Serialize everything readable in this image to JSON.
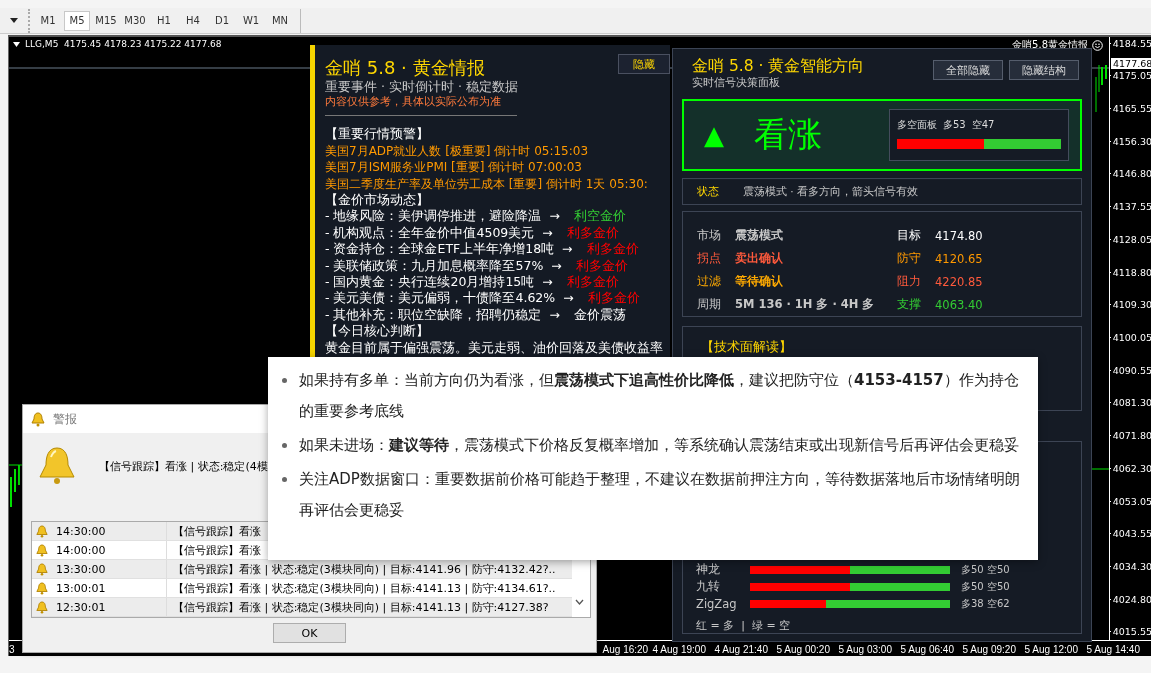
{
  "toolbar": {
    "timeframes": [
      {
        "label": "M1",
        "selected": false
      },
      {
        "label": "M5",
        "selected": true
      },
      {
        "label": "M15",
        "selected": false
      },
      {
        "label": "M30",
        "selected": false
      },
      {
        "label": "H1",
        "selected": false
      },
      {
        "label": "H4",
        "selected": false
      },
      {
        "label": "D1",
        "selected": false
      },
      {
        "label": "W1",
        "selected": false
      },
      {
        "label": "MN",
        "selected": false
      }
    ]
  },
  "chart": {
    "header": "LLG,M5  4175.45 4178.23 4175.22 4177.68",
    "corner_label": "金哨5.8黄金情报",
    "current_price": "4177.68",
    "price_axis": [
      "4184.55",
      "4175.05",
      "4165.55",
      "4156.30",
      "4146.80",
      "4137.55",
      "4128.05",
      "4118.80",
      "4109.30",
      "4100.05",
      "4090.55",
      "4081.30",
      "4071.80",
      "4062.30",
      "4053.05",
      "4043.55",
      "4034.30",
      "4024.80",
      "4015.55"
    ],
    "time_axis": [
      "Aug 16:20",
      "4 Aug 19:00",
      "4 Aug 21:40",
      "5 Aug 00:20",
      "5 Aug 03:00",
      "5 Aug 06:40",
      "5 Aug 09:20",
      "5 Aug 12:00",
      "5 Aug 14:40"
    ],
    "time_axis_first": "3"
  },
  "news_panel": {
    "title": "金哨 5.8 · 黄金情报",
    "subtitle": "重要事件 · 实时倒计时 · 稳定数据",
    "disclaimer": "内容仅供参考，具体以实际公布为准",
    "hide_button": "隐藏",
    "alerts_heading": "【重要行情预警】",
    "alerts": [
      "美国7月ADP就业人数 [极重要] 倒计时 05:15:03",
      "美国7月ISM服务业PMI [重要] 倒计时 07:00:03",
      "美国二季度生产率及单位劳工成本 [重要] 倒计时 1天 05:30:"
    ],
    "market_heading": "【金价市场动态】",
    "market": [
      {
        "text": "- 地缘风险：美伊调停推进，避险降温  →",
        "impact": "利空金价",
        "color": "#33cc33"
      },
      {
        "text": "- 机构观点：全年金价中值4509美元  →",
        "impact": "利多金价",
        "color": "#ff0000"
      },
      {
        "text": "- 资金持仓：全球金ETF上半年净增18吨  →",
        "impact": "利多金价",
        "color": "#ff0000"
      },
      {
        "text": "- 美联储政策：九月加息概率降至57%  →",
        "impact": "利多金价",
        "color": "#ff0000"
      },
      {
        "text": "- 国内黄金：央行连续20月增持15吨  →",
        "impact": "利多金价",
        "color": "#ff0000"
      },
      {
        "text": "- 美元美债：美元偏弱，十债降至4.62%  →",
        "impact": "利多金价",
        "color": "#ff0000"
      },
      {
        "text": "- 其他补充：职位空缺降，招聘仍稳定  →",
        "impact": "金价震荡",
        "color": "#ffffff"
      }
    ],
    "judgement_heading": "【今日核心判断】",
    "judgement": "黄金目前属于偏强震荡。美元走弱、油价回落及美债收益率"
  },
  "signal_panel": {
    "title": "金哨 5.8 · 黄金智能方向",
    "subtitle": "实时信号决策面板",
    "buttons": [
      "全部隐藏",
      "隐藏结构"
    ],
    "signal": {
      "kind": "bullish",
      "arrow": "▲",
      "label": "看涨"
    },
    "balance": {
      "title": "多空面板",
      "long": "多53",
      "short": "空47",
      "level": 0.53
    },
    "status": {
      "label": "状态",
      "text": "震荡模式 · 看多方向，箭头信号有效"
    },
    "fields": [
      {
        "label": "市场",
        "value": "震荡模式",
        "color": "#c8c8c8"
      },
      {
        "label": "拐点",
        "value": "卖出确认",
        "color": "#ff5a3c"
      },
      {
        "label": "过滤",
        "value": "等待确认",
        "color": "#ffaa00"
      },
      {
        "label": "周期",
        "value": "5M 136 · 1H 多 · 4H 多",
        "color": "#c8c8c8"
      }
    ],
    "levels": [
      {
        "label": "目标",
        "value": "4174.80",
        "color": "#ffffff"
      },
      {
        "label": "防守",
        "value": "4120.65",
        "color": "#ff9900"
      },
      {
        "label": "阻力",
        "value": "4220.85",
        "color": "#ff5a3c"
      },
      {
        "label": "支撑",
        "value": "4063.40",
        "color": "#33cc33"
      }
    ],
    "tech_heading": "【技术面解读】",
    "indicators": [
      {
        "name": "神龙",
        "level": 0.5,
        "reading": "多50 空50"
      },
      {
        "name": "九转",
        "level": 0.5,
        "reading": "多50 空50"
      },
      {
        "name": "ZigZag",
        "level": 0.38,
        "reading": "多38 空62"
      }
    ],
    "legend": "红 = 多  |  绿 = 空"
  },
  "alert_dialog": {
    "title": "警报",
    "message": "【信号跟踪】看涨 | 状态:稳定(4模",
    "rows": [
      {
        "time": "14:30:00",
        "text": "【信号跟踪】看涨"
      },
      {
        "time": "14:00:00",
        "text": "【信号跟踪】看涨"
      },
      {
        "time": "13:30:00",
        "text": "【信号跟踪】看涨 | 状态:稳定(3模块同向) | 目标:4141.96 | 防守:4132.42?.."
      },
      {
        "time": "13:00:01",
        "text": "【信号跟踪】看涨 | 状态:稳定(3模块同向) | 目标:4141.13 | 防守:4134.61?.."
      },
      {
        "time": "12:30:01",
        "text": "【信号跟踪】看涨 | 状态:稳定(3模块同向) | 目标:4141.13 | 防守:4127.38?"
      }
    ],
    "ok_button": "OK"
  },
  "tooltip": {
    "bullets": [
      "如果持有多单：当前方向仍为看涨，但**震荡模式下追高性价比降低**，建议把防守位（**4153-4157**）作为持仓的重要参考底线",
      "如果未进场：**建议等待**，震荡模式下价格反复概率增加，等系统确认震荡结束或出现新信号后再评估会更稳妥",
      "关注ADP数据窗口：重要数据前价格可能趋于整理，不建议在数据前押注方向，等待数据落地后市场情绪明朗再评估会更稳妥"
    ]
  }
}
